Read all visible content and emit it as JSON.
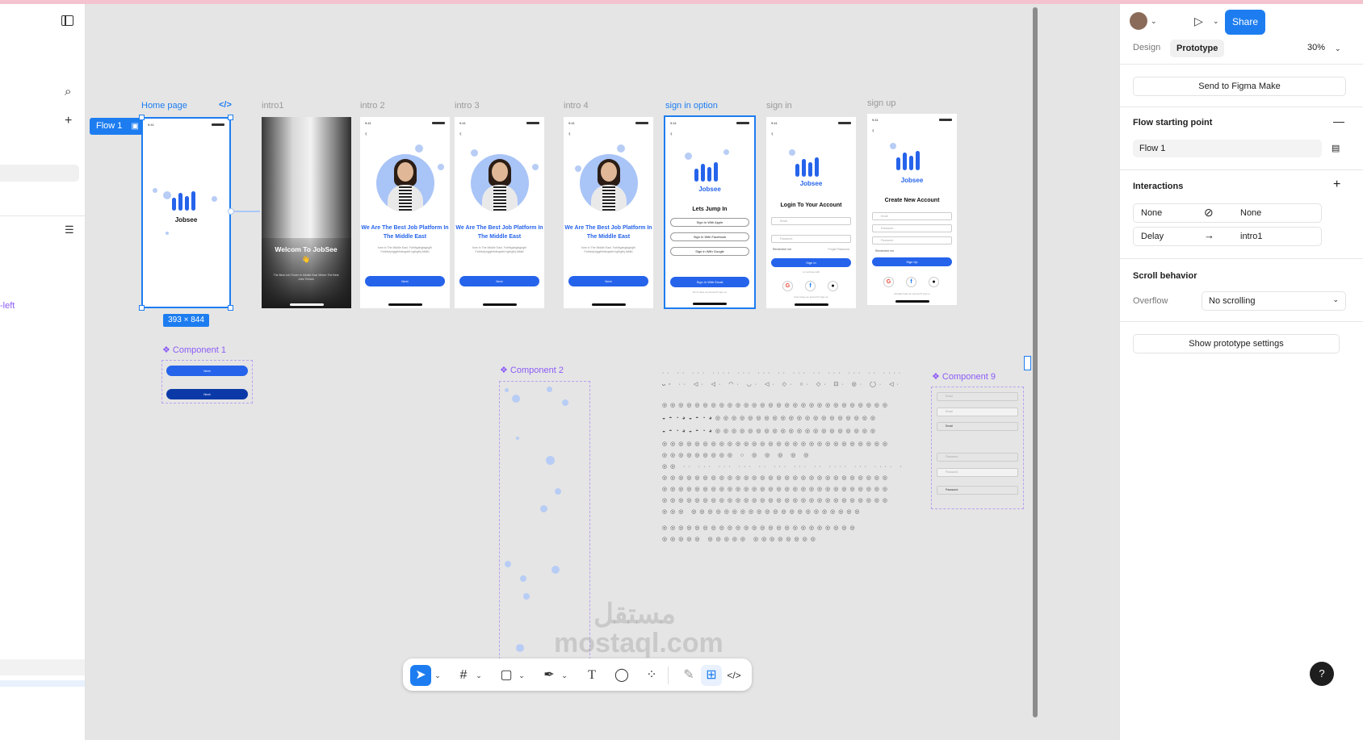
{
  "left_panel": {
    "partial_text": "-left"
  },
  "canvas": {
    "flow_tag": {
      "label": "Flow 1"
    },
    "frames": [
      {
        "id": "home",
        "label": "Home page",
        "brand": "Jobsee"
      },
      {
        "id": "intro1",
        "label": "intro1",
        "title": "Welcom To JobSee 👋",
        "text": "The Best Job Finder In Middle East Where The Best Jobs Thrives"
      },
      {
        "id": "intro2",
        "label": "intro 2",
        "title": "We Are The Best Job Platform In The Middle East",
        "text": "form in The Middle East. Fahfhgahgfaghgfh Fzdfdsfyhyjgfhfsfeqsdfd hgfhgfhj fdfdfd",
        "button": "Next"
      },
      {
        "id": "intro3",
        "label": "intro 3",
        "title": "We Are The Best Job Platform In The Middle East",
        "text": "form in The Middle East. Fahfhgahgfaghgfh Fzdfdsfyhyjgfhfsfeqsdfd hgfhgfhj fdfdfd",
        "button": "Next"
      },
      {
        "id": "intro4",
        "label": "intro 4",
        "title": "We Are The Best Job Platform In The Middle East",
        "text": "form in The Middle East. Fahfhgahgfaghgfh Fzdfdsfyhyjgfhfsfeqsdfd hgfhgfhj fdfdfd",
        "button": "Next"
      },
      {
        "id": "signin_option",
        "label": "sign in option",
        "brand": "Jobsee",
        "heading": "Lets Jump In",
        "options": [
          "Sign In With Apple",
          "Sign In With Facebook",
          "Sign In With Google"
        ],
        "button": "Sign In With Email",
        "footer": "Don't have an account? sign up"
      },
      {
        "id": "signin",
        "label": "sign in",
        "brand": "Jobsee",
        "heading": "Login To Your Account",
        "fields": [
          "Email",
          "Password"
        ],
        "remember": "Remember me",
        "forgot": "Forget Password",
        "button": "Sign In",
        "divider": "or continue with",
        "footer": "Don't have an account? sign up"
      },
      {
        "id": "signup",
        "label": "sign up",
        "brand": "Jobsee",
        "heading": "Create New Account",
        "fields": [
          "Email",
          "Password",
          "Password"
        ],
        "remember": "Remember me",
        "button": "Sign Up",
        "footer": "Already have an account? sign in"
      }
    ],
    "size_badge": "393 × 844",
    "components": [
      {
        "label": "Component 1",
        "buttons": [
          "Next",
          "Next"
        ]
      },
      {
        "label": "Component 2"
      },
      {
        "label": "Component 9",
        "fields": [
          "Email",
          "Email",
          "Email",
          "Password",
          "Password",
          "Password"
        ]
      }
    ],
    "icon_rows": [
      "·· ·· ··· ···· ··· ··· ·· ··· ·· ··· ··· ·· ···· ··· ··· ·· ···",
      "ᴗ◦ ·· ◁· ◁· ◠· ◡· ◁· ◇· ○· ◇· ⊡· ◎· ◯· ◁· ⊕· ◁· ◁· ◡·",
      "◎◎◎◎◎◎◎◎◎◎◎◎◎◎◎◎◎◎◎◎◎◎◎◎◎◎◎◎",
      "◒◓◔◕◒◓◔◕◎◎◎◎◎◎◎◎◎◎◎◎◎◎◎◎◎◎◎◎",
      "◒◓◔◕◒◓◔◕◎◎◎◎◎◎◎◎◎◎◎◎◎◎◎◎◎◎◎◎",
      "◎◎◎◎◎◎◎◎◎◎◎◎◎◎◎◎◎◎◎◎◎◎◎◎◎◎◎◎",
      "◎◎◎◎◎◎◎◎◎ ○ ◎ ◎ ◎ ◎ ◎",
      "◎◎ ·· ··· ··· ··· ·· ··· ··· ·· ···· ··· ···· ···",
      "◎◎◎◎◎◎◎◎◎◎◎◎◎◎◎◎◎◎◎◎◎◎◎◎◎◎◎◎",
      "◎◎◎◎◎◎◎◎◎◎◎◎◎◎◎◎◎◎◎◎◎◎◎◎◎◎◎◎",
      "◎◎◎◎◎◎◎◎◎◎◎◎◎◎◎◎◎◎◎◎◎◎◎◎◎◎◎◎",
      "◎◎◎ ◎◎◎◎◎◎◎◎◎◎◎◎◎◎◎◎◎◎◎◎◎",
      "◎◎◎◎◎◎◎◎◎◎◎◎◎◎◎◎◎◎◎◎◎◎◎◎",
      "◎◎◎◎◎ ◎◎◎◎◎ ◎◎◎◎◎◎◎◎"
    ],
    "watermark": "مستقل mostaql.com"
  },
  "toolbar": {
    "tools": [
      "move-tool",
      "frame-tool",
      "shape-tool",
      "pen-tool",
      "text-tool",
      "comment-tool",
      "actions-tool",
      "draw-tool",
      "dev-mode-tool",
      "code-tool"
    ]
  },
  "right_panel": {
    "share_label": "Share",
    "tabs": [
      "Design",
      "Prototype"
    ],
    "active_tab": "Prototype",
    "zoom": "30%",
    "send_button": "Send to Figma Make",
    "flow_section": {
      "title": "Flow starting point",
      "flow_name": "Flow 1"
    },
    "interactions": {
      "title": "Interactions",
      "rows": [
        {
          "trigger": "None",
          "target": "None"
        },
        {
          "trigger": "Delay",
          "target": "intro1"
        }
      ]
    },
    "scroll": {
      "title": "Scroll behavior",
      "overflow_label": "Overflow",
      "overflow_value": "No scrolling"
    },
    "settings_button": "Show prototype settings",
    "help": "?"
  },
  "colors": {
    "accent": "#1d7df0",
    "brand_blue": "#2563eb",
    "component": "#8b5cf6"
  }
}
